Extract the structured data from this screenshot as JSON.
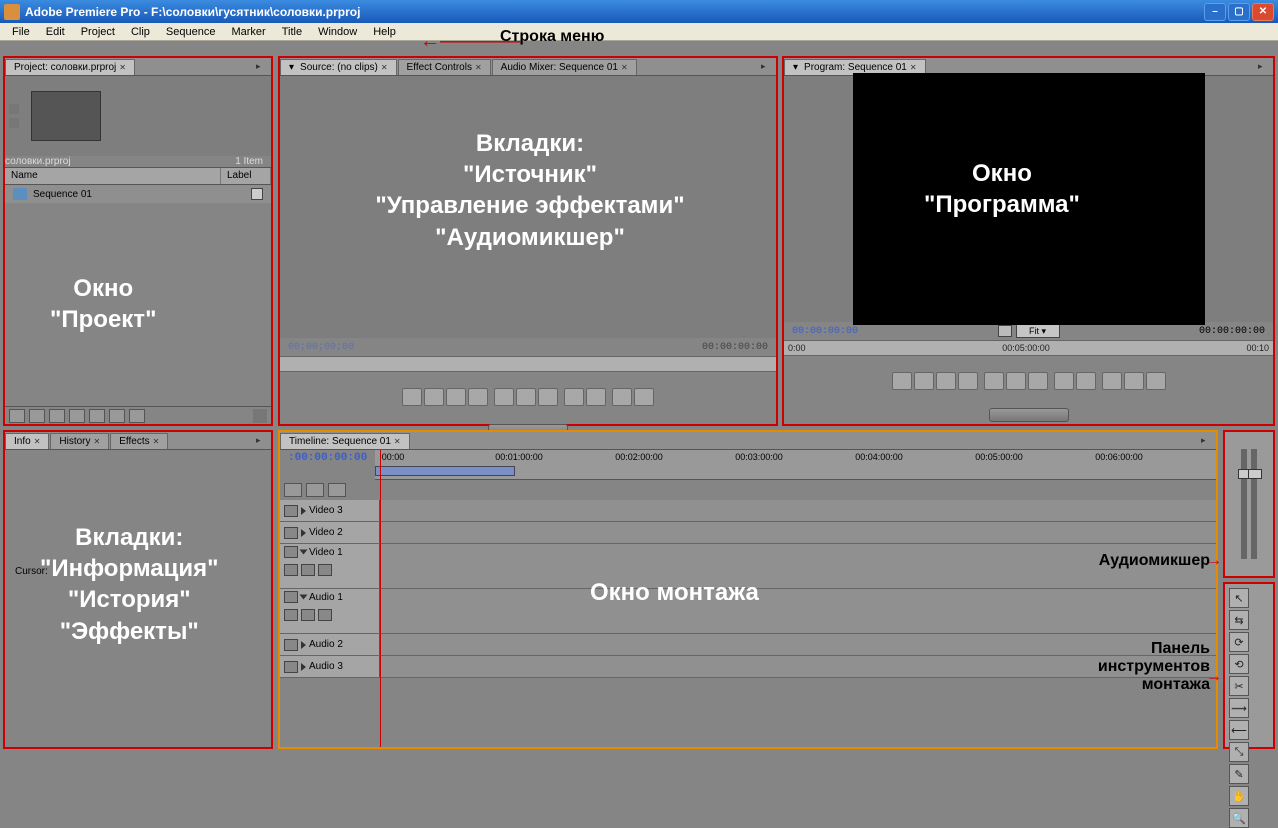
{
  "window": {
    "title": "Adobe Premiere Pro - F:\\соловки\\гусятник\\соловки.prproj"
  },
  "menubar": {
    "items": [
      "File",
      "Edit",
      "Project",
      "Clip",
      "Sequence",
      "Marker",
      "Title",
      "Window",
      "Help"
    ]
  },
  "annotations": {
    "menu_label": "Строка меню",
    "project_window": "Окно\n\"Проект\"",
    "source_tabs": "Вкладки:\n\"Источник\"\n\"Управление эффектами\"\n\"Аудиомикшер\"",
    "program_window": "Окно\n\"Программа\"",
    "info_tabs": "Вкладки:\n\"Информация\"\n\"История\"\n\"Эффекты\"",
    "timeline_window": "Окно монтажа",
    "audiomixer_label": "Аудиомикшер",
    "tools_label": "Панель\nинструментов\nмонтажа"
  },
  "project": {
    "tab": "Project: соловки.prproj",
    "filename": "соловки.prproj",
    "item_count": "1 Item",
    "columns": {
      "name": "Name",
      "label": "Label"
    },
    "items": [
      {
        "name": "Sequence 01"
      }
    ]
  },
  "source": {
    "tabs": [
      "Source: (no clips)",
      "Effect Controls",
      "Audio Mixer: Sequence 01"
    ],
    "tc_left": "00;00;00;00",
    "tc_right": "00:00:00:00"
  },
  "program": {
    "tab": "Program: Sequence 01",
    "tc_left": "00:00:00:00",
    "tc_right": "00:00:00:00",
    "fit": "Fit",
    "ruler": {
      "start": "0:00",
      "mid": "00:05:00:00",
      "end": "00:10"
    }
  },
  "info": {
    "tabs": [
      "Info",
      "History",
      "Effects"
    ],
    "cursor": "Cursor:"
  },
  "timeline": {
    "tab": "Timeline: Sequence 01",
    "playhead": ":00:00:00:00",
    "ruler": [
      ":00:00",
      "00:01:00:00",
      "00:02:00:00",
      "00:03:00:00",
      "00:04:00:00",
      "00:05:00:00",
      "00:06:00:00"
    ],
    "video_tracks": [
      "Video 3",
      "Video 2",
      "Video 1"
    ],
    "audio_tracks": [
      "Audio 1",
      "Audio 2",
      "Audio 3"
    ]
  },
  "tools": {
    "icons": [
      "↖",
      "⇆",
      "⟳",
      "⟲",
      "✂",
      "⟿",
      "⟵",
      "⤡",
      "✎",
      "✋",
      "🔍",
      ""
    ]
  }
}
